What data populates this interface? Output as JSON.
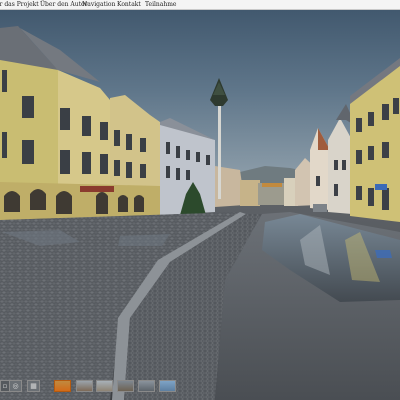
{
  "menu": {
    "items": [
      {
        "label": "er das Projekt"
      },
      {
        "label": "Über den Autor"
      },
      {
        "label": "Navigation"
      },
      {
        "label": "Kontakt"
      },
      {
        "label": "Teilnahme"
      }
    ]
  },
  "panorama": {
    "scene": "town-square-street-view"
  },
  "thumbnails": {
    "controls": [
      "fullscreen-icon",
      "globe-icon",
      "grid-icon"
    ],
    "images": [
      "panorama-thumb-1",
      "panorama-thumb-2",
      "panorama-thumb-3",
      "panorama-thumb-4",
      "panorama-thumb-5",
      "panorama-thumb-6"
    ],
    "selected_index": 0
  },
  "colors": {
    "menu_bg": "#f4f4f4",
    "selected_thumb": "#d36a18"
  }
}
